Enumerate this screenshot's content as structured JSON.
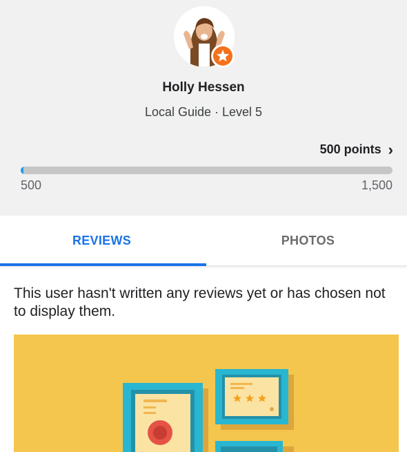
{
  "profile": {
    "name": "Holly Hessen",
    "level_label": "Local Guide · Level 5",
    "points_label": "500 points",
    "progress": {
      "min_label": "500",
      "max_label": "1,500",
      "fraction": 0.0
    },
    "badge_icon": "star-badge-icon"
  },
  "tabs": [
    {
      "label": "REVIEWS",
      "active": true
    },
    {
      "label": "PHOTOS",
      "active": false
    }
  ],
  "reviews": {
    "empty_message": "This user hasn't written any reviews yet or has chosen not to display them."
  },
  "colors": {
    "accent": "#1a73e8",
    "progress_fill": "#1a9ef0",
    "badge": "#f4711c",
    "illustration_bg": "#f5c64d"
  }
}
